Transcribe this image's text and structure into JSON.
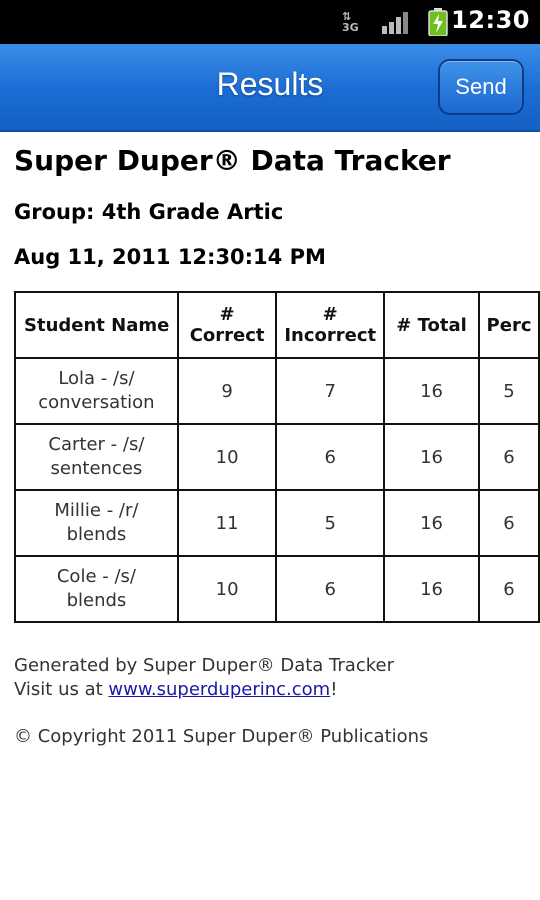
{
  "status_bar": {
    "network": "3G",
    "time": "12:30"
  },
  "header": {
    "title": "Results",
    "send_label": "Send"
  },
  "report": {
    "heading": "Super Duper® Data Tracker",
    "group": "Group: 4th Grade Artic",
    "date": "Aug 11, 2011 12:30:14 PM"
  },
  "table": {
    "headers": {
      "name": "Student Name",
      "correct_l1": "#",
      "correct_l2": "Correct",
      "incorrect_l1": "#",
      "incorrect_l2": "Incorrect",
      "total": "# Total",
      "percent": "Perc"
    },
    "rows": [
      {
        "name_l1": "Lola - /s/",
        "name_l2": "conversation",
        "correct": "9",
        "incorrect": "7",
        "total": "16",
        "percent": "5"
      },
      {
        "name_l1": "Carter - /s/",
        "name_l2": "sentences",
        "correct": "10",
        "incorrect": "6",
        "total": "16",
        "percent": "6"
      },
      {
        "name_l1": "Millie - /r/",
        "name_l2": "blends",
        "correct": "11",
        "incorrect": "5",
        "total": "16",
        "percent": "6"
      },
      {
        "name_l1": "Cole - /s/",
        "name_l2": "blends",
        "correct": "10",
        "incorrect": "6",
        "total": "16",
        "percent": "6"
      }
    ]
  },
  "footer": {
    "generated": "Generated by Super Duper® Data Tracker",
    "visit_prefix": "Visit us at ",
    "link": "www.superduperinc.com",
    "visit_suffix": "!",
    "copyright": "© Copyright 2011 Super Duper® Publications"
  },
  "colors": {
    "header_blue": "#1a6cd4",
    "link": "#1a1aa6"
  }
}
